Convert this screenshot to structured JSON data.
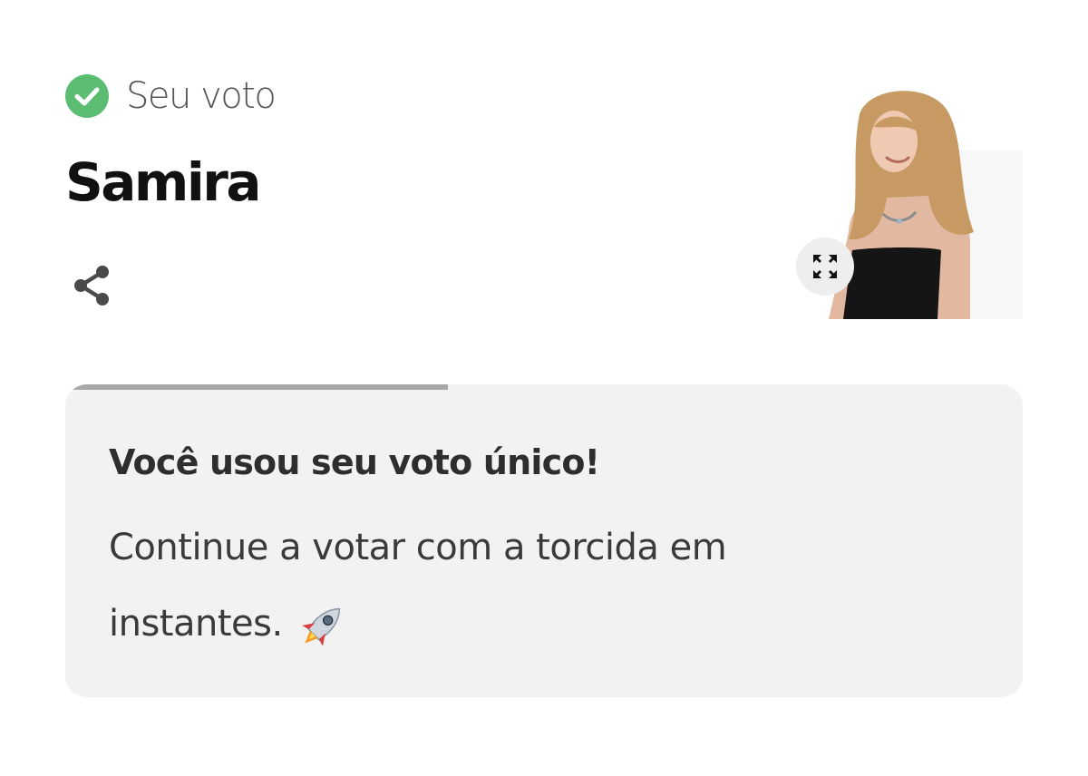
{
  "vote": {
    "status_label": "Seu voto",
    "candidate_name": "Samira",
    "status_color": "#5bbd72"
  },
  "icons": {
    "status": "check-circle-icon",
    "share": "share-icon",
    "expand": "expand-icon",
    "emoji": "rocket-icon"
  },
  "photo": {
    "alt": "Samira"
  },
  "notice": {
    "title": "Você usou seu voto único!",
    "message": "Continue a votar com a torcida em instantes.",
    "progress": 0.4,
    "emoji": "🚀"
  }
}
